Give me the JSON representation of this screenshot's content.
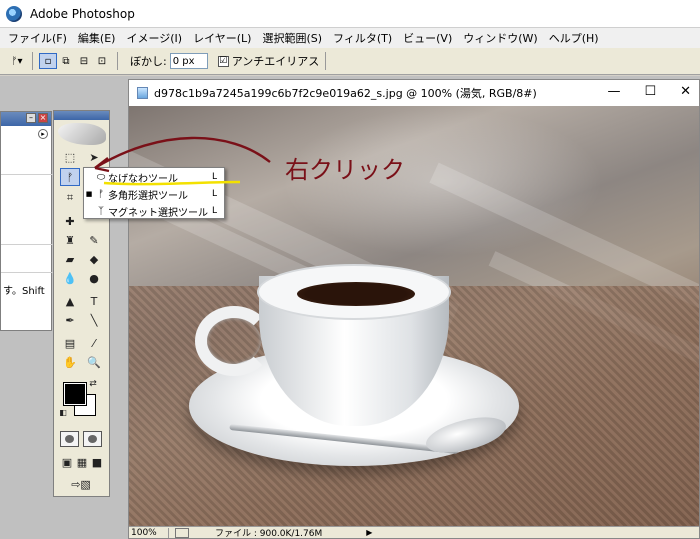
{
  "app": {
    "title": "Adobe Photoshop"
  },
  "menubar": {
    "items": [
      "ファイル(F)",
      "編集(E)",
      "イメージ(I)",
      "レイヤー(L)",
      "選択範囲(S)",
      "フィルタ(T)",
      "ビュー(V)",
      "ウィンドウ(W)",
      "ヘルプ(H)"
    ]
  },
  "options": {
    "feather_label": "ぼかし:",
    "feather_value": "0 px",
    "antialias_label": "アンチエイリアス",
    "antialias_checked": "☑"
  },
  "left_panel": {
    "text": "す。Shift"
  },
  "document": {
    "title": "d978c1b9a7245a199c6b7f2c9e019a62_s.jpg @ 100% (湯気, RGB/8#)",
    "zoom": "100%",
    "file_info": "ファイル : 900.0K/1.76M"
  },
  "flyout": {
    "items": [
      {
        "label": "なげなわツール",
        "key": "L"
      },
      {
        "label": "多角形選択ツール",
        "key": "L"
      },
      {
        "label": "マグネット選択ツール",
        "key": "L"
      }
    ]
  },
  "annotation": {
    "text": "右クリック",
    "color": "#7a1018",
    "highlight": "#f3e100"
  }
}
